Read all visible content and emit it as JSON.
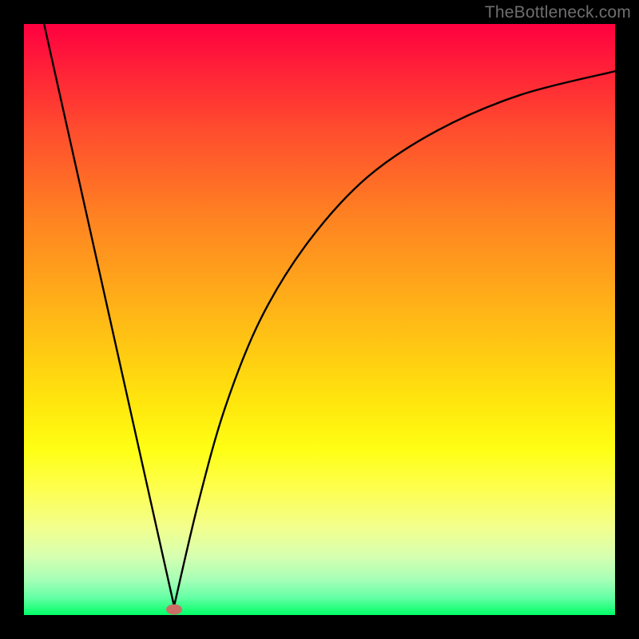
{
  "watermark": "TheBottleneck.com",
  "chart_data": {
    "type": "line",
    "title": "",
    "xlabel": "",
    "ylabel": "",
    "xlim": [
      0,
      100
    ],
    "ylim": [
      0,
      100
    ],
    "curve": {
      "note": "V-shaped bottleneck curve; vertex near x≈25, y≈0; left branch steep and near-linear to top-left corner; right branch decelerating rise to upper right.",
      "left_branch": [
        {
          "x": 3.4,
          "y": 100
        },
        {
          "x": 25.4,
          "y": 1.5
        }
      ],
      "right_branch": [
        {
          "x": 25.4,
          "y": 1.5
        },
        {
          "x": 29.5,
          "y": 19
        },
        {
          "x": 34.0,
          "y": 35
        },
        {
          "x": 40.0,
          "y": 50
        },
        {
          "x": 48.0,
          "y": 63
        },
        {
          "x": 58.0,
          "y": 74
        },
        {
          "x": 70.0,
          "y": 82
        },
        {
          "x": 84.0,
          "y": 88
        },
        {
          "x": 100.0,
          "y": 92
        }
      ],
      "marker": {
        "x": 25.4,
        "y": 1.0
      }
    },
    "gradient_stops": [
      {
        "pos": 0,
        "color": "#ff0040"
      },
      {
        "pos": 50,
        "color": "#ffb317"
      },
      {
        "pos": 75,
        "color": "#ffff14"
      },
      {
        "pos": 100,
        "color": "#00ff66"
      }
    ],
    "marker_color": "#cc6e66"
  }
}
